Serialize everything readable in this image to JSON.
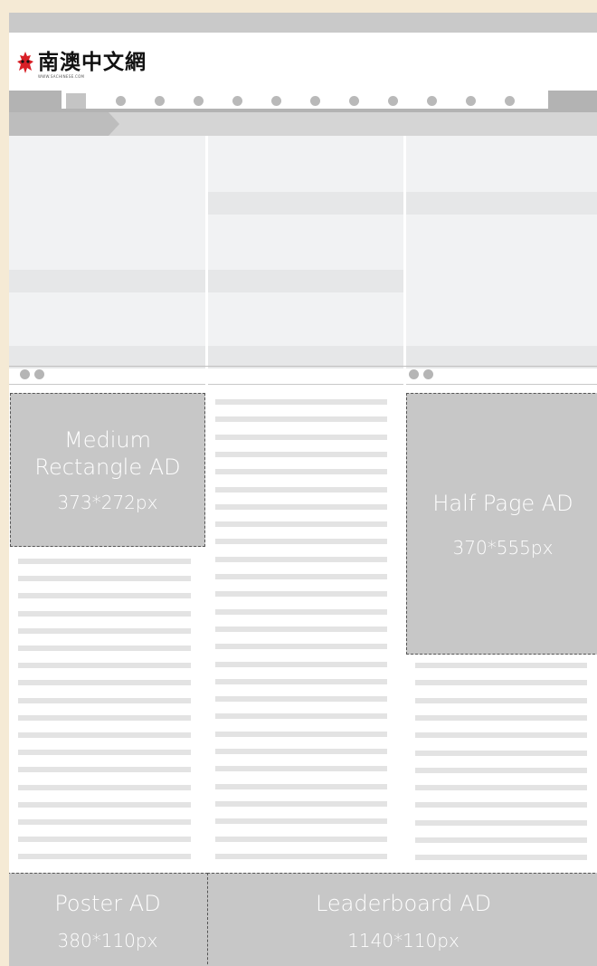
{
  "logo": {
    "text": "南澳中文網",
    "sub": "WWW.SACHINESE.COM",
    "mark_color": "#d81f26"
  },
  "ads": {
    "medium_rectangle": {
      "title": "Medium\nRectangle AD",
      "size": "373*272px"
    },
    "half_page": {
      "title": "Half Page AD",
      "size": "370*555px"
    },
    "poster": {
      "title": "Poster AD",
      "size": "380*110px"
    },
    "leaderboard": {
      "title": "Leaderboard AD",
      "size": "1140*110px"
    }
  },
  "colors": {
    "background": "#f5ead5",
    "ad_fill": "#c7c7c7",
    "ad_text": "#ffffff",
    "placeholder_line": "#e3e3e3"
  }
}
